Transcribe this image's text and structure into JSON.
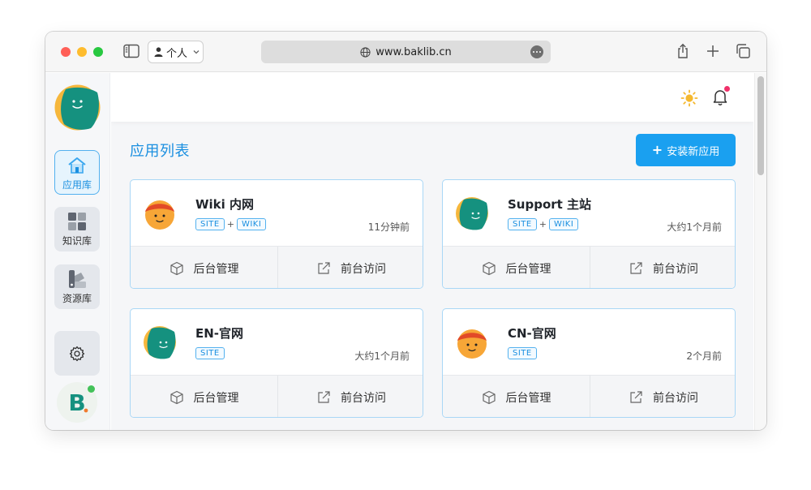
{
  "browser": {
    "profile_label": "个人",
    "url": "www.baklib.cn"
  },
  "sidebar": {
    "items": [
      {
        "label": "应用库",
        "icon": "home-icon",
        "active": true
      },
      {
        "label": "知识库",
        "icon": "grid-icon",
        "active": false
      },
      {
        "label": "资源库",
        "icon": "swatch-icon",
        "active": false
      }
    ],
    "settings_icon": "gear-icon",
    "brand_letter": "B"
  },
  "header": {
    "theme_icon": "sun-icon",
    "notification_icon": "bell-icon"
  },
  "main": {
    "title": "应用列表",
    "install_button": "安装新应用",
    "plus": "+"
  },
  "apps": [
    {
      "name": "Wiki 内网",
      "tags": [
        "SITE",
        "WIKI"
      ],
      "time": "11分钟前",
      "avatar": "orange-face-avatar"
    },
    {
      "name": "Support 主站",
      "tags": [
        "SITE",
        "WIKI"
      ],
      "time": "大约1个月前",
      "avatar": "green-face-avatar"
    },
    {
      "name": "EN-官网",
      "tags": [
        "SITE"
      ],
      "time": "大约1个月前",
      "avatar": "green-face-avatar"
    },
    {
      "name": "CN-官网",
      "tags": [
        "SITE"
      ],
      "time": "2个月前",
      "avatar": "orange-face-avatar"
    }
  ],
  "card_actions": {
    "admin": "后台管理",
    "visit": "前台访问",
    "tag_joiner": "+"
  },
  "colors": {
    "accent": "#1aa0f0",
    "title": "#1a8fe0",
    "card_border": "#a9d7f6",
    "notification_dot": "#f0306a"
  }
}
